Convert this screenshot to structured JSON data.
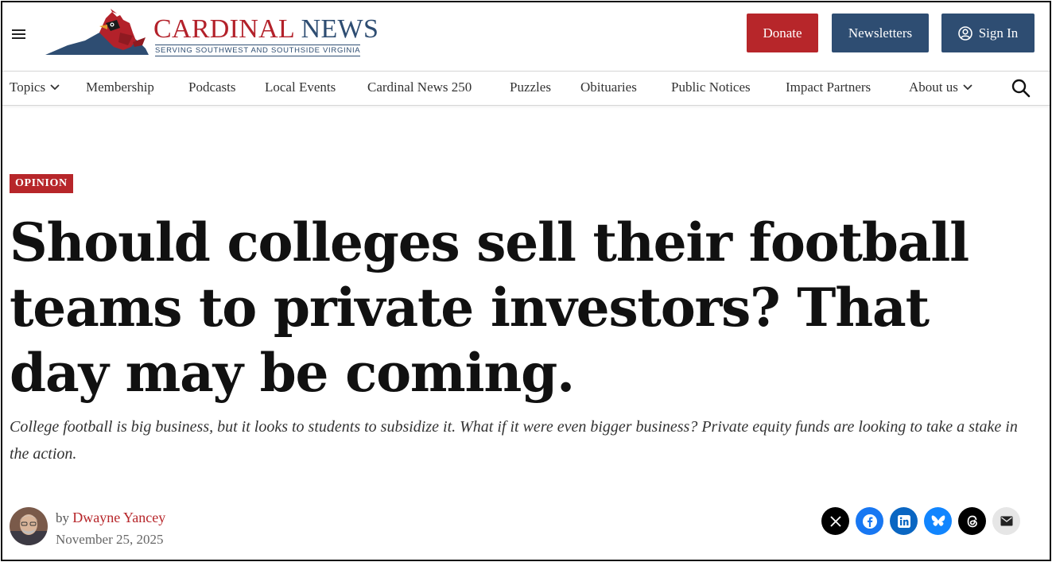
{
  "header": {
    "logo": {
      "title_part1": "CARDINAL",
      "title_part2": "NEWS",
      "tagline": "SERVING SOUTHWEST AND SOUTHSIDE VIRGINIA"
    },
    "buttons": {
      "donate": "Donate",
      "newsletters": "Newsletters",
      "sign_in": "Sign In"
    }
  },
  "nav": {
    "items": [
      {
        "label": "Topics",
        "has_dropdown": true
      },
      {
        "label": "Membership"
      },
      {
        "label": "Podcasts"
      },
      {
        "label": "Local Events"
      },
      {
        "label": "Cardinal News 250"
      },
      {
        "label": "Puzzles"
      },
      {
        "label": "Obituaries"
      },
      {
        "label": "Public Notices"
      },
      {
        "label": "Impact Partners"
      },
      {
        "label": "About us",
        "has_dropdown": true
      }
    ]
  },
  "article": {
    "category": "OPINION",
    "headline": "Should colleges sell their football teams to private investors? That day may be coming.",
    "dek": "College football is big business, but it looks to students to subsidize it. What if it were even bigger business? Private equity funds are looking to take a stake in the action.",
    "byline_prefix": "by",
    "author": "Dwayne Yancey",
    "date": "November 25, 2025"
  },
  "share": [
    {
      "icon": "x-icon",
      "color": "#000000"
    },
    {
      "icon": "facebook-icon",
      "color": "#1877f2"
    },
    {
      "icon": "linkedin-icon",
      "color": "#0a66c2"
    },
    {
      "icon": "bluesky-icon",
      "color": "#1185fe"
    },
    {
      "icon": "threads-icon",
      "color": "#000000"
    },
    {
      "icon": "email-icon",
      "color": "#e6e6e6"
    }
  ],
  "colors": {
    "brand_red": "#b7262a",
    "brand_blue": "#2e4d72"
  }
}
